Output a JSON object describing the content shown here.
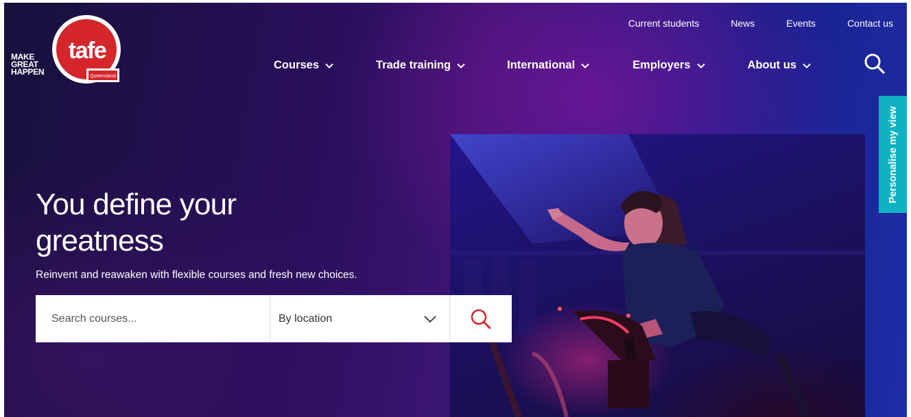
{
  "brand": {
    "tagline_lines": [
      "MAKE",
      "GREAT",
      "HAPPEN"
    ],
    "logo_word": "tafe",
    "logo_sub": "Queensland",
    "logo_color": "#d4262b"
  },
  "utility_nav": [
    "Current students",
    "News",
    "Events",
    "Contact us"
  ],
  "main_nav": [
    {
      "label": "Courses",
      "icon": "chevron-down-icon"
    },
    {
      "label": "Trade training",
      "icon": "chevron-down-icon"
    },
    {
      "label": "International",
      "icon": "chevron-down-icon"
    },
    {
      "label": "Employers",
      "icon": "chevron-down-icon"
    },
    {
      "label": "About us",
      "icon": "chevron-down-icon"
    }
  ],
  "personalise_label": "Personalise my view",
  "hero": {
    "title": "You define your greatness",
    "subtitle": "Reinvent and reawaken with flexible courses and fresh new choices."
  },
  "search": {
    "placeholder": "Search courses...",
    "location_label": "By location",
    "button_icon": "search-icon"
  },
  "colors": {
    "accent_red": "#d4262b",
    "teal": "#0fb3c0"
  }
}
